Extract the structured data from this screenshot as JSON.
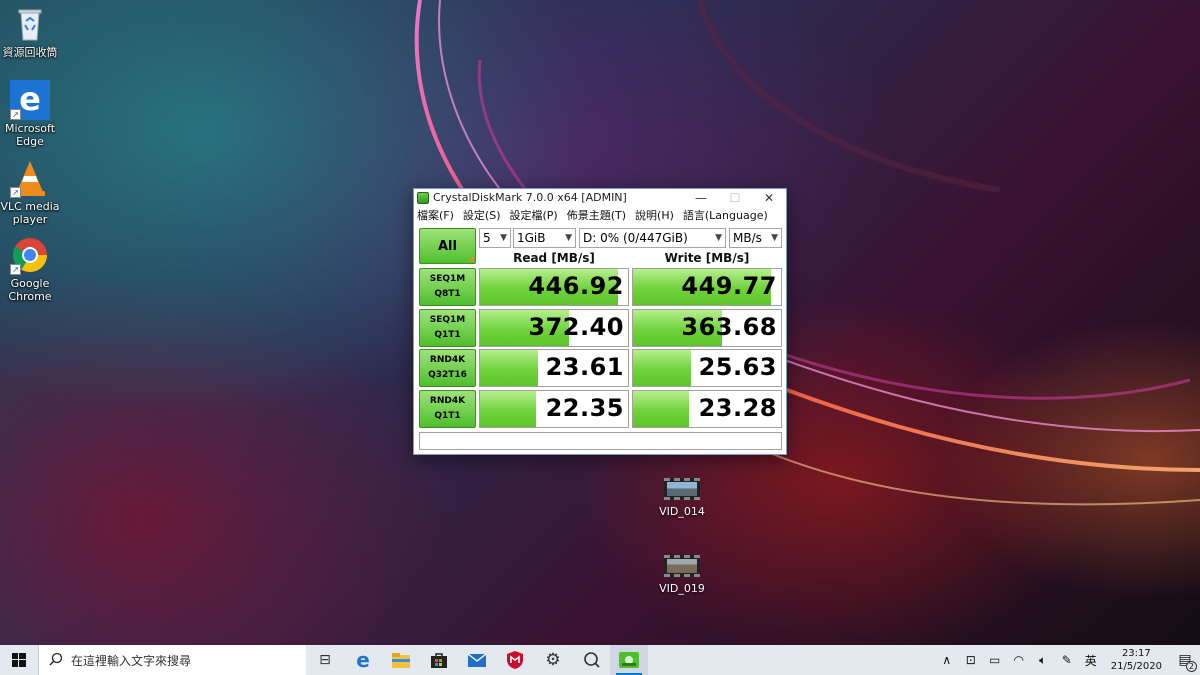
{
  "desktop": {
    "icons": [
      {
        "label": "資源回收筒",
        "icon": "recycle-bin-icon"
      },
      {
        "label": "Microsoft Edge",
        "icon": "edge-icon"
      },
      {
        "label": "VLC media player",
        "icon": "vlc-icon"
      },
      {
        "label": "Google Chrome",
        "icon": "chrome-icon"
      }
    ],
    "files": [
      {
        "label": "VID_014",
        "icon": "video-file-icon"
      },
      {
        "label": "VID_019",
        "icon": "video-file-icon"
      }
    ]
  },
  "window": {
    "title": "CrystalDiskMark 7.0.0 x64 [ADMIN]",
    "controls": {
      "minimize": "—",
      "maximize": "☐",
      "close": "✕"
    },
    "menu": [
      "檔案(F)",
      "設定(S)",
      "設定檔(P)",
      "佈景主題(T)",
      "說明(H)",
      "語言(Language)"
    ],
    "all_label": "All",
    "count": "5",
    "size": "1GiB",
    "drive": "D: 0% (0/447GiB)",
    "unit": "MB/s",
    "read_header": "Read [MB/s]",
    "write_header": "Write [MB/s]",
    "tests": [
      {
        "line1": "SEQ1M",
        "line2": "Q8T1",
        "read": "446.92",
        "write": "449.77",
        "read_fill": 0.93,
        "write_fill": 0.93
      },
      {
        "line1": "SEQ1M",
        "line2": "Q1T1",
        "read": "372.40",
        "write": "363.68",
        "read_fill": 0.6,
        "write_fill": 0.6
      },
      {
        "line1": "RND4K",
        "line2": "Q32T16",
        "read": "23.61",
        "write": "25.63",
        "read_fill": 0.39,
        "write_fill": 0.39
      },
      {
        "line1": "RND4K",
        "line2": "Q1T1",
        "read": "22.35",
        "write": "23.28",
        "read_fill": 0.38,
        "write_fill": 0.38
      }
    ],
    "status": ""
  },
  "taskbar": {
    "search_placeholder": "在這裡輸入文字來搜尋",
    "apps": [
      "task-view-icon",
      "edge-icon",
      "file-explorer-icon",
      "store-icon",
      "mail-icon",
      "mcafee-icon",
      "settings-icon",
      "feedback-icon",
      "crystaldiskmark-icon"
    ],
    "ime": "英",
    "time": "23:17",
    "date": "21/5/2020",
    "notification_count": "2"
  },
  "colors": {
    "bar_green": "#6fd33c",
    "button_green": "#4fbf2d",
    "accent": "#0078d7"
  }
}
